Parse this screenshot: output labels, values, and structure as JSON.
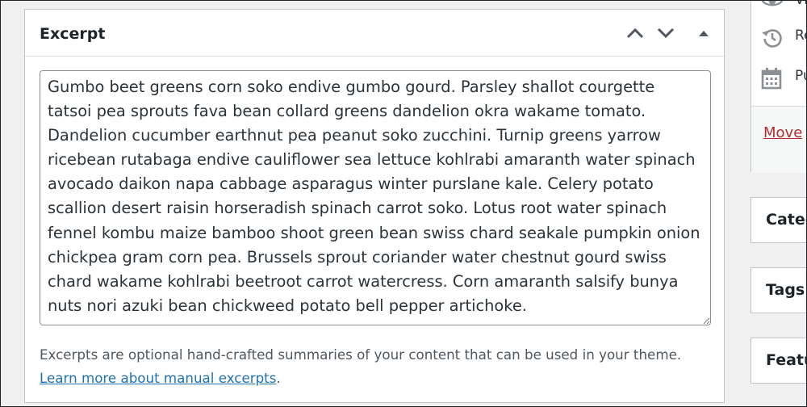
{
  "excerpt_box": {
    "title": "Excerpt",
    "move_up_label": "Move up",
    "move_down_label": "Move down",
    "toggle_label": "Toggle panel",
    "textarea_value": "Gumbo beet greens corn soko endive gumbo gourd. Parsley shallot courgette tatsoi pea sprouts fava bean collard greens dandelion okra wakame tomato. Dandelion cucumber earthnut pea peanut soko zucchini. Turnip greens yarrow ricebean rutabaga endive cauliflower sea lettuce kohlrabi amaranth water spinach avocado daikon napa cabbage asparagus winter purslane kale. Celery potato scallion desert raisin horseradish spinach carrot soko. Lotus root water spinach fennel kombu maize bamboo shoot green bean swiss chard seakale pumpkin onion chickpea gram corn pea. Brussels sprout coriander water chestnut gourd swiss chard wakame kohlrabi beetroot carrot watercress. Corn amaranth salsify bunya nuts nori azuki bean chickweed potato bell pepper artichoke.",
    "help_text": "Excerpts are optional hand-crafted summaries of your content that can be used in your theme.",
    "help_link": "Learn more about manual excerpts",
    "help_suffix": "."
  },
  "sidebar": {
    "publish": {
      "visibility_label": "Vi",
      "revisions_label": "Re",
      "publish_label": "Pu",
      "trash_link": "Move"
    },
    "categories_title": "Categ",
    "tags_title": "Tags",
    "featured_title": "Featu"
  },
  "colors": {
    "accent_link": "#2271b1",
    "trash_link": "#b32d2e",
    "border": "#c3c4c7",
    "background": "#f0f0f1"
  },
  "icons": {
    "move_up": "chevron-up-icon",
    "move_down": "chevron-down-icon",
    "toggle": "triangle-up-icon",
    "visibility": "eye-icon",
    "revisions": "history-icon",
    "publish": "calendar-icon"
  }
}
